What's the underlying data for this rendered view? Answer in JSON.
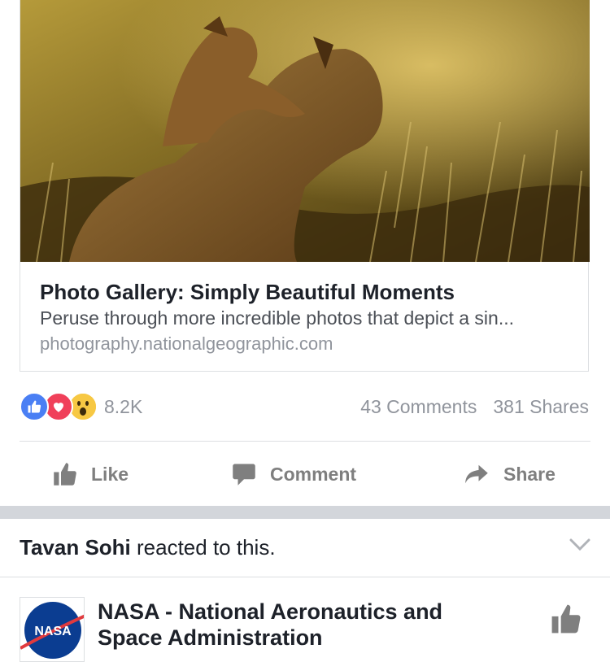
{
  "link_card": {
    "title": "Photo Gallery: Simply Beautiful Moments",
    "description": "Peruse through more incredible photos that depict a sin...",
    "domain": "photography.nationalgeographic.com"
  },
  "stats": {
    "reaction_icons": [
      "like-icon",
      "love-icon",
      "wow-icon"
    ],
    "reaction_count": "8.2K",
    "comments": "43 Comments",
    "shares": "381 Shares"
  },
  "actions": {
    "like_label": "Like",
    "comment_label": "Comment",
    "share_label": "Share"
  },
  "next_story": {
    "actor": "Tavan Sohi",
    "reaction_text": " reacted to this.",
    "page_name": "NASA - National Aeronautics and Space Administration",
    "avatar_text": "NASA"
  },
  "colors": {
    "like_blue": "#4a7ff4",
    "love_red": "#f0405a",
    "wow_yellow": "#f7c843",
    "action_gray": "#7f7f7f",
    "meta_gray": "#90949c"
  }
}
